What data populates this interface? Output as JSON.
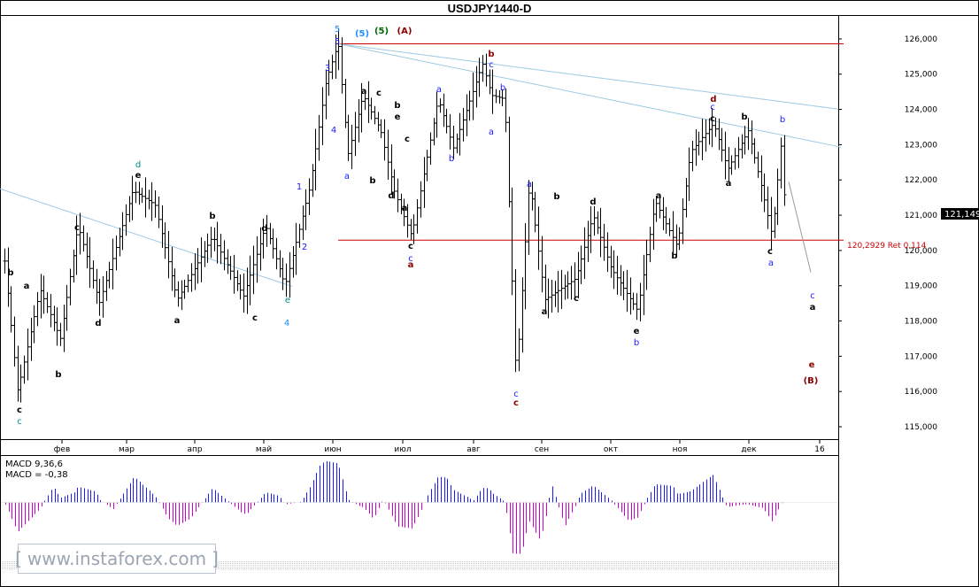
{
  "chart_data": {
    "type": "candlestick",
    "title": "USDJPY1440-D",
    "x_labels": [
      "фев",
      "мар",
      "апр",
      "май",
      "июн",
      "июл",
      "авг",
      "сен",
      "окт",
      "ноя",
      "дек",
      "16"
    ],
    "y_ticks": [
      "126,000",
      "125,000",
      "124,000",
      "123,000",
      "122,000",
      "121,000",
      "120,000",
      "119,000",
      "118,000",
      "117,000",
      "116,000",
      "115,000"
    ],
    "ylim": [
      114.8,
      126.5
    ],
    "current_price": "121,149",
    "retracement": {
      "level": 120.2929,
      "label": "120,2929 Ret 0,114"
    },
    "resistance_level": 125.86,
    "trendlines": [
      {
        "from": [
          "янв",
          121.75
        ],
        "to": [
          "май",
          118.98
        ]
      },
      {
        "from": [
          "июн",
          125.86
        ],
        "to": [
          "16",
          124.0
        ]
      },
      {
        "from": [
          "июн",
          125.86
        ],
        "to": [
          "16",
          122.93
        ]
      }
    ],
    "projection": {
      "from": [
        "дек",
        121.95
      ],
      "to": [
        "16",
        119.38
      ]
    },
    "wave_labels": [
      {
        "text": "5",
        "color": "#1e90ff",
        "at": [
          "июн",
          126.1
        ]
      },
      {
        "text": "5",
        "color": "#1a1aff",
        "at": [
          "июн",
          125.95
        ]
      },
      {
        "text": "(5)",
        "color": "#1e90ff",
        "at": [
          "июн",
          126.0
        ]
      },
      {
        "text": "(5)",
        "color": "#006400",
        "at": [
          "июн",
          126.0
        ]
      },
      {
        "text": "(A)",
        "color": "#8b0000",
        "at": [
          "июн",
          126.0
        ]
      },
      {
        "text": "3",
        "color": "#1a1aff",
        "at": [
          "июн",
          125.3
        ]
      },
      {
        "text": "4",
        "color": "#1a1aff",
        "at": [
          "июн",
          123.7
        ]
      },
      {
        "text": "1",
        "color": "#1a1aff",
        "at": [
          "май",
          122.0
        ]
      },
      {
        "text": "2",
        "color": "#1a1aff",
        "at": [
          "май",
          120.3
        ]
      },
      {
        "text": "e",
        "color": "#008b8b",
        "at": [
          "май",
          119.3
        ]
      },
      {
        "text": "4",
        "color": "#1e90ff",
        "at": [
          "май",
          118.4
        ]
      },
      {
        "text": "b",
        "color": "#000000",
        "at": [
          "янв",
          119.7
        ]
      },
      {
        "text": "a",
        "color": "#000000",
        "at": [
          "янв",
          119.4
        ]
      },
      {
        "text": "b",
        "color": "#000000",
        "at": [
          "янв",
          116.8
        ]
      },
      {
        "text": "c",
        "color": "#000000",
        "at": [
          "янв",
          115.8
        ]
      },
      {
        "text": "c",
        "color": "#008b8b",
        "at": [
          "янв",
          115.5
        ]
      },
      {
        "text": "c",
        "color": "#000000",
        "at": [
          "фев",
          120.7
        ]
      },
      {
        "text": "d",
        "color": "#000000",
        "at": [
          "фев",
          118.5
        ]
      },
      {
        "text": "d",
        "color": "#008b8b",
        "at": [
          "фев",
          122.4
        ]
      },
      {
        "text": "e",
        "color": "#000000",
        "at": [
          "мар",
          122.1
        ]
      },
      {
        "text": "b",
        "color": "#000000",
        "at": [
          "мар",
          121.1
        ]
      },
      {
        "text": "a",
        "color": "#000000",
        "at": [
          "апр",
          118.5
        ]
      },
      {
        "text": "c",
        "color": "#000000",
        "at": [
          "май",
          118.6
        ]
      },
      {
        "text": "d",
        "color": "#000000",
        "at": [
          "май",
          120.7
        ]
      },
      {
        "text": "a",
        "color": "#000000",
        "at": [
          "июн",
          124.9
        ]
      },
      {
        "text": "b",
        "color": "#000000",
        "at": [
          "июн",
          122.0
        ]
      },
      {
        "text": "c",
        "color": "#000000",
        "at": [
          "июн",
          124.8
        ]
      },
      {
        "text": "a",
        "color": "#1a1aff",
        "at": [
          "июн",
          122.5
        ]
      },
      {
        "text": "d",
        "color": "#000000",
        "at": [
          "июн",
          121.7
        ]
      },
      {
        "text": "e",
        "color": "#000000",
        "at": [
          "июл",
          124.1
        ]
      },
      {
        "text": "b",
        "color": "#000000",
        "at": [
          "июл",
          124.5
        ]
      },
      {
        "text": "c",
        "color": "#000000",
        "at": [
          "июл",
          123.3
        ]
      },
      {
        "text": "a",
        "color": "#000000",
        "at": [
          "июл",
          121.4
        ]
      },
      {
        "text": "c",
        "color": "#000000",
        "at": [
          "июл",
          120.3
        ]
      },
      {
        "text": "c",
        "color": "#1a1aff",
        "at": [
          "июл",
          120.0
        ]
      },
      {
        "text": "a",
        "color": "#8b0000",
        "at": [
          "июл",
          119.8
        ]
      },
      {
        "text": "b",
        "color": "#1a1aff",
        "at": [
          "июл",
          122.9
        ]
      },
      {
        "text": "a",
        "color": "#1a1aff",
        "at": [
          "авг",
          124.9
        ]
      },
      {
        "text": "b",
        "color": "#8b0000",
        "at": [
          "авг",
          125.8
        ]
      },
      {
        "text": "c",
        "color": "#1a1aff",
        "at": [
          "авг",
          125.5
        ]
      },
      {
        "text": "b",
        "color": "#1a1aff",
        "at": [
          "авг",
          124.9
        ]
      },
      {
        "text": "a",
        "color": "#1a1aff",
        "at": [
          "авг",
          123.5
        ]
      },
      {
        "text": "c",
        "color": "#1a1aff",
        "at": [
          "авг",
          116.2
        ]
      },
      {
        "text": "c",
        "color": "#8b0000",
        "at": [
          "авг",
          115.9
        ]
      },
      {
        "text": "a",
        "color": "#1a1aff",
        "at": [
          "сен",
          121.9
        ]
      },
      {
        "text": "b",
        "color": "#000000",
        "at": [
          "сен",
          121.6
        ]
      },
      {
        "text": "a",
        "color": "#000000",
        "at": [
          "сен",
          118.4
        ]
      },
      {
        "text": "c",
        "color": "#000000",
        "at": [
          "сен",
          118.7
        ]
      },
      {
        "text": "d",
        "color": "#000000",
        "at": [
          "окт",
          121.5
        ]
      },
      {
        "text": "e",
        "color": "#000000",
        "at": [
          "окт",
          117.8
        ]
      },
      {
        "text": "b",
        "color": "#1a1aff",
        "at": [
          "окт",
          117.5
        ]
      },
      {
        "text": "a",
        "color": "#000000",
        "at": [
          "окт",
          121.6
        ]
      },
      {
        "text": "b",
        "color": "#000000",
        "at": [
          "окт",
          119.9
        ]
      },
      {
        "text": "d",
        "color": "#8b0000",
        "at": [
          "ноя",
          124.5
        ]
      },
      {
        "text": "c",
        "color": "#1a1aff",
        "at": [
          "ноя",
          124.2
        ]
      },
      {
        "text": "c",
        "color": "#000000",
        "at": [
          "ноя",
          124.0
        ]
      },
      {
        "text": "b",
        "color": "#000000",
        "at": [
          "ноя",
          124.0
        ]
      },
      {
        "text": "a",
        "color": "#000000",
        "at": [
          "ноя",
          122.1
        ]
      },
      {
        "text": "b",
        "color": "#1a1aff",
        "at": [
          "дек",
          123.9
        ]
      },
      {
        "text": "c",
        "color": "#000000",
        "at": [
          "дек",
          120.1
        ]
      },
      {
        "text": "a",
        "color": "#1a1aff",
        "at": [
          "дек",
          119.8
        ]
      },
      {
        "text": "c",
        "color": "#1a1aff",
        "at": [
          "16",
          119.0
        ]
      },
      {
        "text": "a",
        "color": "#000000",
        "at": [
          "16",
          118.7
        ]
      },
      {
        "text": "e",
        "color": "#8b0000",
        "at": [
          "16",
          117.0
        ]
      },
      {
        "text": "(B)",
        "color": "#8b0000",
        "at": [
          "16",
          116.6
        ]
      }
    ],
    "indicator": {
      "name": "MACD",
      "params_label": "MACD 9,36,6",
      "value_label": "MACD = -0,38",
      "value": -0.38,
      "positive_color": "#1a1aff",
      "negative_color": "#cc00cc"
    }
  },
  "watermark": "www.instaforex.com",
  "colors": {
    "price_line": "#cc0000",
    "trendline": "#9ecae1",
    "candle": "#000000",
    "axis": "#000000"
  }
}
